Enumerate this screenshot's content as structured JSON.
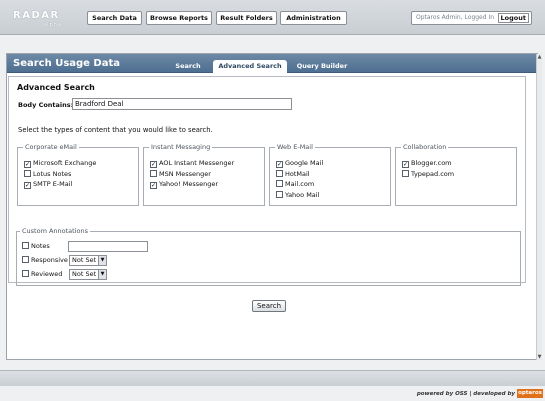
{
  "brand": {
    "logo_text": "RADAR",
    "logo_sub": "alpha"
  },
  "nav": [
    {
      "label": "Search Data"
    },
    {
      "label": "Browse Reports"
    },
    {
      "label": "Result Folders"
    },
    {
      "label": "Administration"
    }
  ],
  "user": {
    "status": "Optaros Admin, Logged In",
    "logout": "Logout"
  },
  "panel": {
    "title": "Search Usage Data",
    "tabs": [
      {
        "label": "Search",
        "active": false
      },
      {
        "label": "Advanced Search",
        "active": true
      },
      {
        "label": "Query Builder",
        "active": false
      }
    ]
  },
  "advanced": {
    "heading": "Advanced Search",
    "body_label": "Body Contains:",
    "body_value": "Bradford Deal",
    "intro": "Select the types of content that you would like to search.",
    "groups": [
      {
        "legend": "Corporate eMail",
        "options": [
          {
            "label": "Microsoft Exchange",
            "checked": true
          },
          {
            "label": "Lotus Notes",
            "checked": false
          },
          {
            "label": "SMTP E-Mail",
            "checked": true
          }
        ]
      },
      {
        "legend": "Instant Messaging",
        "options": [
          {
            "label": "AOL Instant Messenger",
            "checked": true
          },
          {
            "label": "MSN Messenger",
            "checked": false
          },
          {
            "label": "Yahoo! Messenger",
            "checked": true
          }
        ]
      },
      {
        "legend": "Web E-Mail",
        "options": [
          {
            "label": "Google Mail",
            "checked": true
          },
          {
            "label": "HotMail",
            "checked": false
          },
          {
            "label": "Mail.com",
            "checked": false
          },
          {
            "label": "Yahoo Mail",
            "checked": false
          }
        ]
      },
      {
        "legend": "Collaboration",
        "options": [
          {
            "label": "Blogger.com",
            "checked": true
          },
          {
            "label": "Typepad.com",
            "checked": false
          }
        ]
      }
    ]
  },
  "annotations": {
    "legend": "Custom Annotations",
    "notes_label": "Notes",
    "notes_value": "",
    "responsive_label": "Responsive",
    "responsive_value": "Not Set",
    "reviewed_label": "Reviewed",
    "reviewed_value": "Not Set"
  },
  "actions": {
    "search": "Search"
  },
  "footer": {
    "credit": "powered by OSS | developed by",
    "logo": "optaros"
  }
}
